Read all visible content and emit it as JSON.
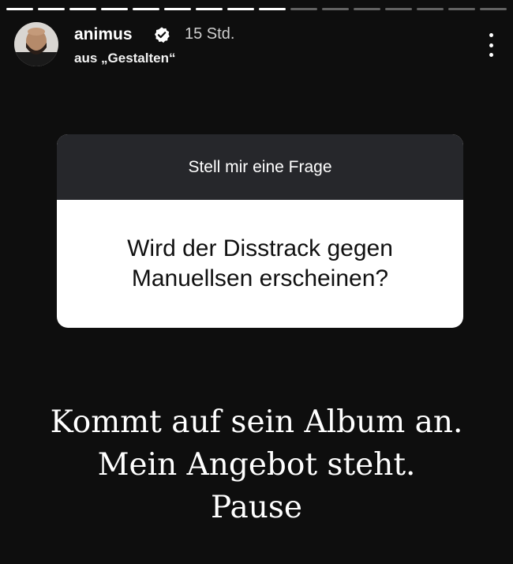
{
  "progress": {
    "segments_total": 16,
    "segments_viewed": 9
  },
  "header": {
    "username": "animus",
    "verified_icon": "verified-badge-icon",
    "time": "15 Std.",
    "source": "aus „Gestalten“",
    "more_icon": "more-vertical-icon"
  },
  "sticker": {
    "title": "Stell mir eine Frage",
    "question_line1": "Wird der Disstrack gegen",
    "question_line2": "Manuellsen erscheinen?"
  },
  "answer": {
    "line1": "Kommt auf sein Album an.",
    "line2": "Mein Angebot steht.",
    "line3": "Pause"
  },
  "colors": {
    "background": "#0e0e0e",
    "sticker_header": "#26272b",
    "sticker_body": "#ffffff"
  }
}
